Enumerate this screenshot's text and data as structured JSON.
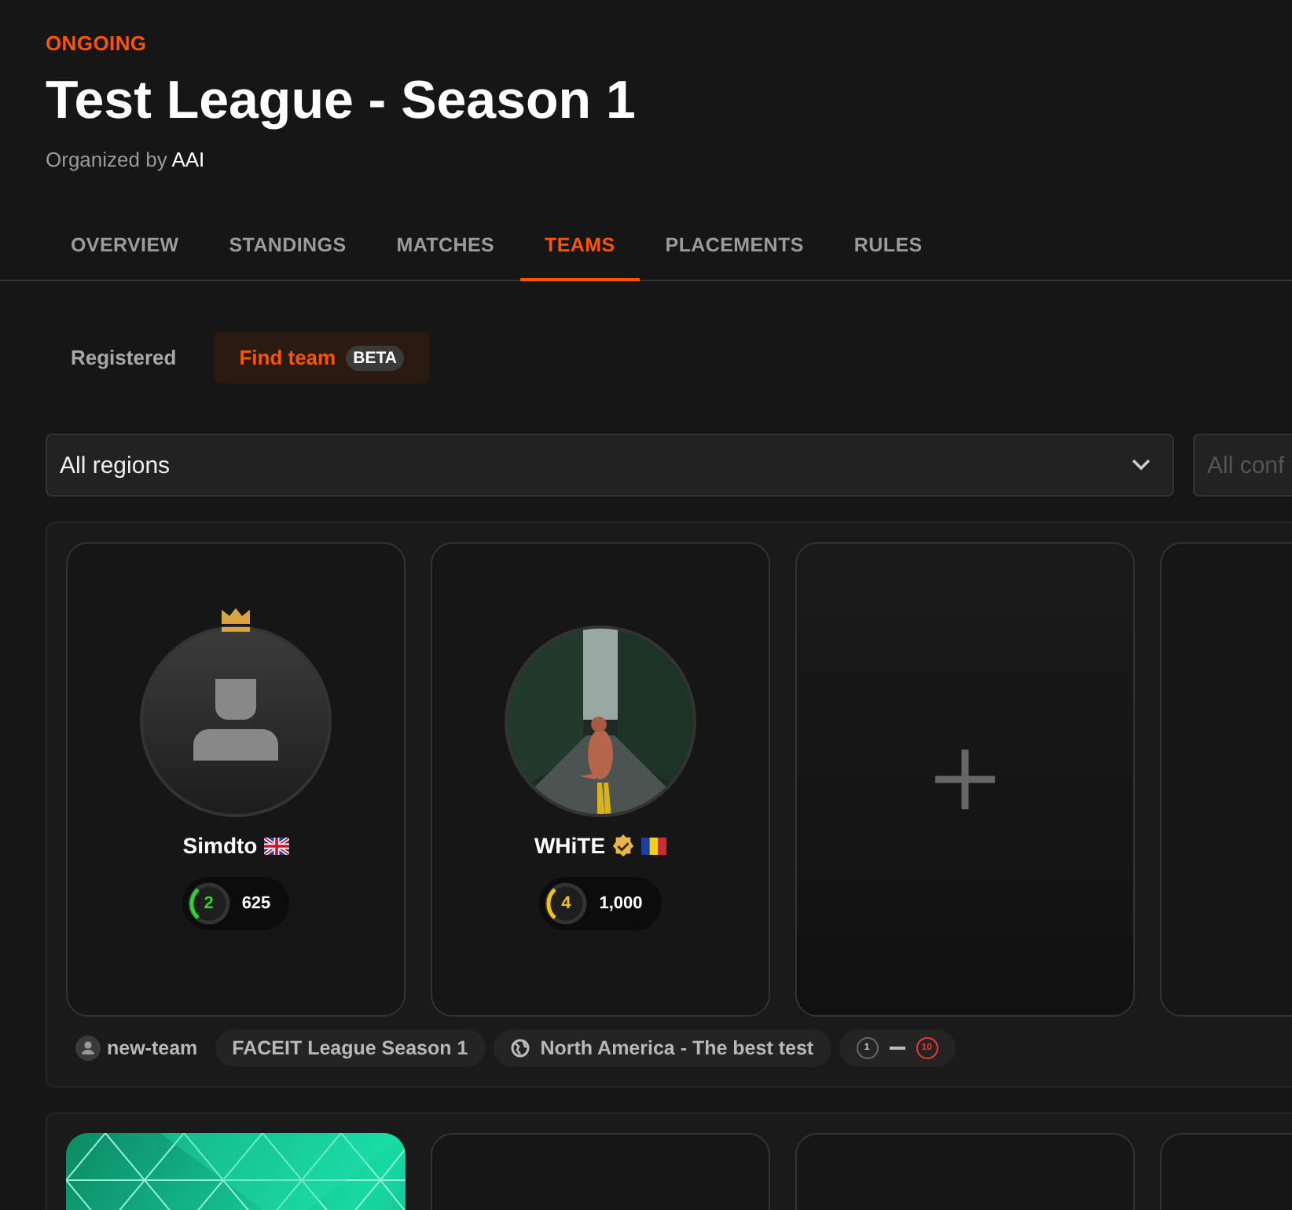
{
  "status": "ONGOING",
  "title": "Test League - Season 1",
  "organizer": {
    "prefix": "Organized by",
    "name": "AAI"
  },
  "tabs": [
    {
      "label": "OVERVIEW",
      "selected": false
    },
    {
      "label": "STANDINGS",
      "selected": false
    },
    {
      "label": "MATCHES",
      "selected": false
    },
    {
      "label": "TEAMS",
      "selected": true
    },
    {
      "label": "PLACEMENTS",
      "selected": false
    },
    {
      "label": "RULES",
      "selected": false
    }
  ],
  "subtabs": [
    {
      "label": "Registered",
      "selected": false
    },
    {
      "label": "Find team",
      "badge": "BETA",
      "selected": true
    }
  ],
  "filters": [
    {
      "value": "All regions"
    },
    {
      "placeholder": "All conf"
    }
  ],
  "teams": [
    {
      "slots": [
        {
          "kind": "player",
          "name": "Simdto",
          "captain": true,
          "verified": false,
          "avatar": {
            "kind": "default"
          },
          "flag": {
            "kind": "gb"
          },
          "skill_level": "2",
          "color": "#2fd52f",
          "elo": "625"
        },
        {
          "kind": "player",
          "name": "WHiTE",
          "captain": false,
          "verified": true,
          "avatar": {
            "kind": "picture"
          },
          "flag": {
            "kind": "ro"
          },
          "skill_level": "4",
          "color": "#f2c311",
          "elo": "1,000"
        },
        {
          "kind": "add"
        },
        {
          "kind": "empty"
        }
      ],
      "name": "new-team",
      "league": "FACEIT League Season 1",
      "region": "North America - The best test",
      "level_min": "1",
      "level_max": "10"
    },
    {
      "slots": [
        {
          "kind": "picture"
        },
        {
          "kind": "empty"
        },
        {
          "kind": "empty"
        },
        {
          "kind": "empty"
        }
      ]
    }
  ]
}
